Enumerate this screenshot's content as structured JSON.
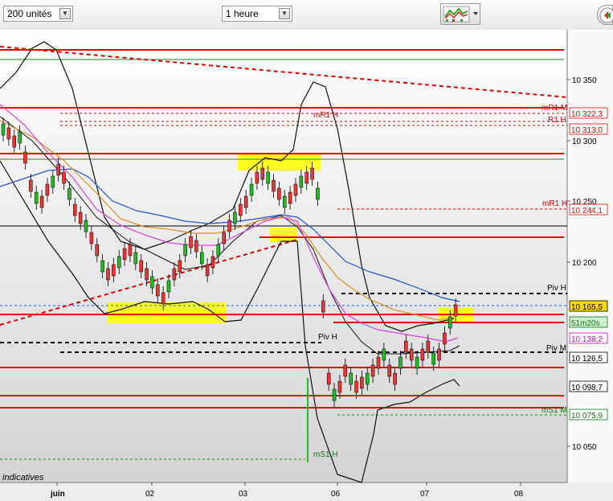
{
  "toolbar": {
    "quantity_value": "200 unités",
    "period_value": "1 heure",
    "indicators_icon": "chart-indicators-icon",
    "nav_icon": "back-forward-icon"
  },
  "chart_data": {
    "type": "candlestick",
    "note_label": "indicatives",
    "x_tick_labels": [
      "juin",
      "02",
      "03",
      "06",
      "07",
      "08"
    ],
    "y_tick_labels": [
      "10 350",
      "10 300",
      "10 250",
      "10 200",
      "10 050"
    ],
    "ylim": [
      10025,
      10375
    ],
    "colors": {
      "up": "#22bb22",
      "down": "#ee3333",
      "level": "#e60000",
      "boll": "#111111",
      "ma_blue": "#2255dd",
      "ma_orange": "#e09020",
      "ma_magenta": "#e040e0",
      "highlight": "#ffff00",
      "pivot_black": "#000000",
      "support_green": "#228822"
    },
    "price_labels": [
      {
        "text": "10 322,3",
        "value": 10322.3,
        "color": "#e60000"
      },
      {
        "text": "10 313,0",
        "value": 10313.0,
        "color": "#e60000"
      },
      {
        "text": "10 244,1",
        "value": 10244.1,
        "color": "#e60000"
      },
      {
        "text": "10 165,5",
        "value": 10165.5,
        "color": "#000000",
        "bg": "#ffd700"
      },
      {
        "text": "51m20s",
        "value": 10155.5,
        "color": "#117711",
        "bg": "#cfeecf"
      },
      {
        "text": "10 138,2",
        "value": 10138.2,
        "color": "#cc00cc"
      },
      {
        "text": "10 126,5",
        "value": 10126.5,
        "color": "#000000"
      },
      {
        "text": "10 098,7",
        "value": 10098.7,
        "color": "#000000"
      },
      {
        "text": "10 075,9",
        "value": 10075.9,
        "color": "#117711"
      }
    ],
    "level_labels": [
      {
        "text": "mR1 M",
        "value": 10324,
        "color": "#e60000"
      },
      {
        "text": "R1 H",
        "value": 10314,
        "color": "#e60000"
      },
      {
        "text": "mR1 H",
        "value": 10319,
        "color": "#e60000"
      },
      {
        "text": "mR1 H",
        "value": 10247,
        "color": "#e60000"
      },
      {
        "text": "Piv H",
        "value": 10178,
        "color": "#000000"
      },
      {
        "text": "Piv H",
        "value": 10139,
        "color": "#000000"
      },
      {
        "text": "Piv M",
        "value": 10131,
        "color": "#000000"
      },
      {
        "text": "mS1 M",
        "value": 10078,
        "color": "#117711"
      },
      {
        "text": "mS1 H",
        "value": 10043,
        "color": "#117711"
      }
    ]
  }
}
